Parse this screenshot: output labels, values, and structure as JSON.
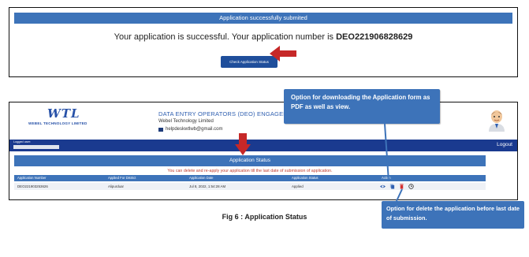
{
  "success": {
    "header": "Application successfully submited",
    "message": "Your application is successful. Your application number is ",
    "application_number": "DEO221906828629",
    "check_button": "Check Application Status"
  },
  "portal": {
    "logo_mark": "WTL",
    "logo_subtitle": "WEBEL TECHNOLOGY LIMITED",
    "title": "DATA ENTRY OPERATORS (DEO) ENGAGEMENT",
    "organisation": "Webel Technology Limited",
    "email": "helpdeskwtlwb@gmail.com",
    "logged_user_label": "Logged user:",
    "logout": "Logout",
    "status_header": "Application Status",
    "note": "You can delete and re-apply your application till the last date of submission of application.",
    "columns": [
      "Application Number",
      "Applied For District",
      "Application Date",
      "Application Status",
      "Action"
    ],
    "row": {
      "number": "DEO221903253626",
      "district": "Alipurduar",
      "date": "Jul 8, 2022, 1:54:28 AM",
      "status": "Applied"
    }
  },
  "callouts": {
    "download": "Option for downloading the Application form as PDF as well as view.",
    "delete": "Option for delete the application before last date of submission."
  },
  "caption": "Fig 6 :   Application Status",
  "colors": {
    "primary_blue": "#3d73b9",
    "dark_blue": "#1a3a8f",
    "arrow_red": "#c62828",
    "note_red": "#c0392b"
  },
  "icons": [
    "view-eye-icon",
    "pdf-copy-icon",
    "delete-trash-icon",
    "history-clock-icon",
    "mail-icon",
    "avatar-icon"
  ]
}
